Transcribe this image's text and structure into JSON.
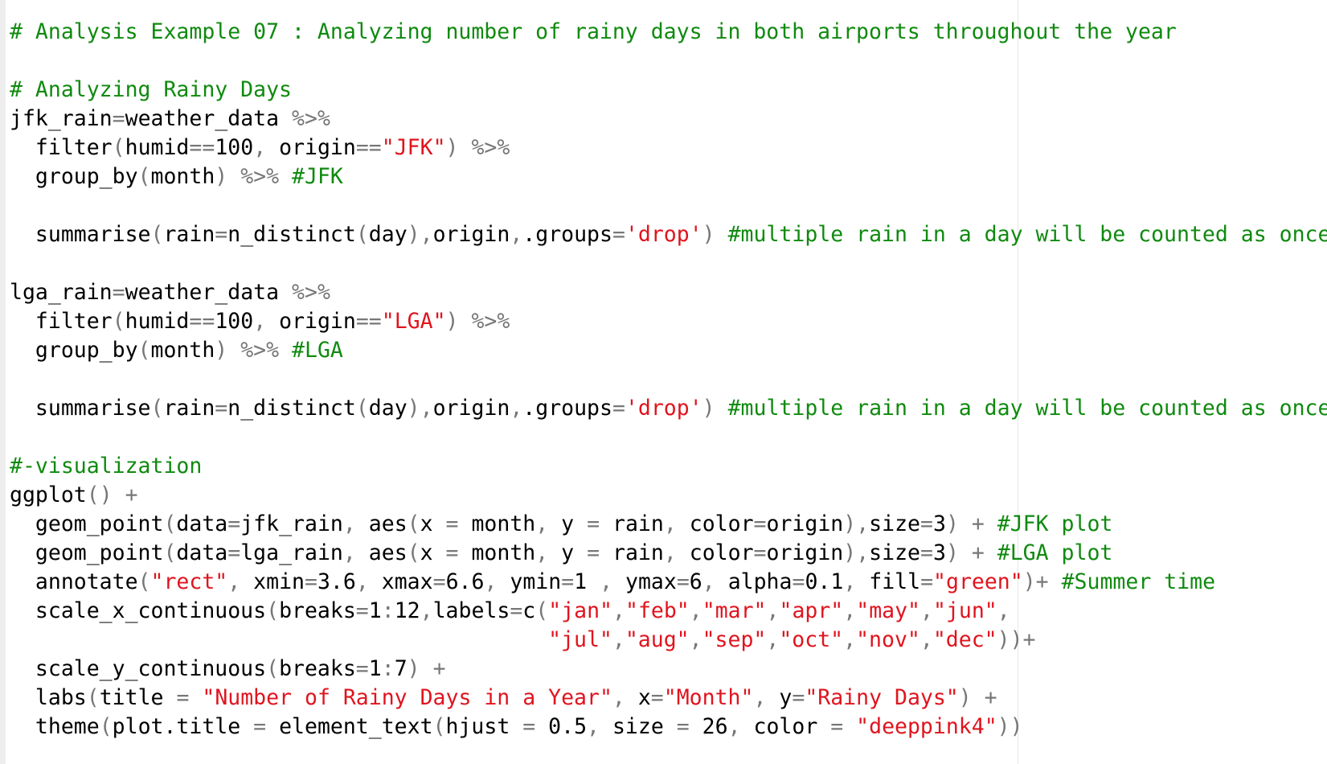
{
  "editor": {
    "language": "R",
    "colors": {
      "comment": "#0f8a0f",
      "string": "#e0141e",
      "operator": "#777777",
      "plain": "#000000",
      "background": "#ffffff"
    },
    "lines": [
      [
        {
          "t": "comment",
          "v": "# Analysis Example 07 : Analyzing number of rainy days in both airports throughout the year"
        }
      ],
      [],
      [
        {
          "t": "comment",
          "v": "# Analyzing Rainy Days"
        }
      ],
      [
        {
          "t": "plain",
          "v": "jfk_rain"
        },
        {
          "t": "op",
          "v": "="
        },
        {
          "t": "plain",
          "v": "weather_data "
        },
        {
          "t": "op",
          "v": "%>%"
        }
      ],
      [
        {
          "t": "plain",
          "v": "  filter"
        },
        {
          "t": "op",
          "v": "("
        },
        {
          "t": "plain",
          "v": "humid"
        },
        {
          "t": "op",
          "v": "=="
        },
        {
          "t": "plain",
          "v": "100"
        },
        {
          "t": "op",
          "v": ", "
        },
        {
          "t": "plain",
          "v": "origin"
        },
        {
          "t": "op",
          "v": "=="
        },
        {
          "t": "string",
          "v": "\"JFK\""
        },
        {
          "t": "op",
          "v": ") %>%"
        }
      ],
      [
        {
          "t": "plain",
          "v": "  group_by"
        },
        {
          "t": "op",
          "v": "("
        },
        {
          "t": "plain",
          "v": "month"
        },
        {
          "t": "op",
          "v": ") %>% "
        },
        {
          "t": "comment",
          "v": "#JFK"
        }
      ],
      [],
      [
        {
          "t": "plain",
          "v": "  summarise"
        },
        {
          "t": "op",
          "v": "("
        },
        {
          "t": "plain",
          "v": "rain"
        },
        {
          "t": "op",
          "v": "="
        },
        {
          "t": "plain",
          "v": "n_distinct"
        },
        {
          "t": "op",
          "v": "("
        },
        {
          "t": "plain",
          "v": "day"
        },
        {
          "t": "op",
          "v": "),"
        },
        {
          "t": "plain",
          "v": "origin"
        },
        {
          "t": "op",
          "v": ","
        },
        {
          "t": "plain",
          "v": ".groups"
        },
        {
          "t": "op",
          "v": "="
        },
        {
          "t": "string",
          "v": "'drop'"
        },
        {
          "t": "op",
          "v": ") "
        },
        {
          "t": "comment",
          "v": "#multiple rain in a day will be counted as once"
        }
      ],
      [],
      [
        {
          "t": "plain",
          "v": "lga_rain"
        },
        {
          "t": "op",
          "v": "="
        },
        {
          "t": "plain",
          "v": "weather_data "
        },
        {
          "t": "op",
          "v": "%>%"
        }
      ],
      [
        {
          "t": "plain",
          "v": "  filter"
        },
        {
          "t": "op",
          "v": "("
        },
        {
          "t": "plain",
          "v": "humid"
        },
        {
          "t": "op",
          "v": "=="
        },
        {
          "t": "plain",
          "v": "100"
        },
        {
          "t": "op",
          "v": ", "
        },
        {
          "t": "plain",
          "v": "origin"
        },
        {
          "t": "op",
          "v": "=="
        },
        {
          "t": "string",
          "v": "\"LGA\""
        },
        {
          "t": "op",
          "v": ") %>%"
        }
      ],
      [
        {
          "t": "plain",
          "v": "  group_by"
        },
        {
          "t": "op",
          "v": "("
        },
        {
          "t": "plain",
          "v": "month"
        },
        {
          "t": "op",
          "v": ") %>% "
        },
        {
          "t": "comment",
          "v": "#LGA"
        }
      ],
      [],
      [
        {
          "t": "plain",
          "v": "  summarise"
        },
        {
          "t": "op",
          "v": "("
        },
        {
          "t": "plain",
          "v": "rain"
        },
        {
          "t": "op",
          "v": "="
        },
        {
          "t": "plain",
          "v": "n_distinct"
        },
        {
          "t": "op",
          "v": "("
        },
        {
          "t": "plain",
          "v": "day"
        },
        {
          "t": "op",
          "v": "),"
        },
        {
          "t": "plain",
          "v": "origin"
        },
        {
          "t": "op",
          "v": ","
        },
        {
          "t": "plain",
          "v": ".groups"
        },
        {
          "t": "op",
          "v": "="
        },
        {
          "t": "string",
          "v": "'drop'"
        },
        {
          "t": "op",
          "v": ") "
        },
        {
          "t": "comment",
          "v": "#multiple rain in a day will be counted as once"
        }
      ],
      [],
      [
        {
          "t": "comment",
          "v": "#-visualization"
        }
      ],
      [
        {
          "t": "plain",
          "v": "ggplot"
        },
        {
          "t": "op",
          "v": "() +"
        }
      ],
      [
        {
          "t": "plain",
          "v": "  geom_point"
        },
        {
          "t": "op",
          "v": "("
        },
        {
          "t": "plain",
          "v": "data"
        },
        {
          "t": "op",
          "v": "="
        },
        {
          "t": "plain",
          "v": "jfk_rain"
        },
        {
          "t": "op",
          "v": ", "
        },
        {
          "t": "plain",
          "v": "aes"
        },
        {
          "t": "op",
          "v": "("
        },
        {
          "t": "plain",
          "v": "x "
        },
        {
          "t": "op",
          "v": "= "
        },
        {
          "t": "plain",
          "v": "month"
        },
        {
          "t": "op",
          "v": ", "
        },
        {
          "t": "plain",
          "v": "y "
        },
        {
          "t": "op",
          "v": "= "
        },
        {
          "t": "plain",
          "v": "rain"
        },
        {
          "t": "op",
          "v": ", "
        },
        {
          "t": "plain",
          "v": "color"
        },
        {
          "t": "op",
          "v": "="
        },
        {
          "t": "plain",
          "v": "origin"
        },
        {
          "t": "op",
          "v": "),"
        },
        {
          "t": "plain",
          "v": "size"
        },
        {
          "t": "op",
          "v": "="
        },
        {
          "t": "plain",
          "v": "3"
        },
        {
          "t": "op",
          "v": ") + "
        },
        {
          "t": "comment",
          "v": "#JFK plot"
        }
      ],
      [
        {
          "t": "plain",
          "v": "  geom_point"
        },
        {
          "t": "op",
          "v": "("
        },
        {
          "t": "plain",
          "v": "data"
        },
        {
          "t": "op",
          "v": "="
        },
        {
          "t": "plain",
          "v": "lga_rain"
        },
        {
          "t": "op",
          "v": ", "
        },
        {
          "t": "plain",
          "v": "aes"
        },
        {
          "t": "op",
          "v": "("
        },
        {
          "t": "plain",
          "v": "x "
        },
        {
          "t": "op",
          "v": "= "
        },
        {
          "t": "plain",
          "v": "month"
        },
        {
          "t": "op",
          "v": ", "
        },
        {
          "t": "plain",
          "v": "y "
        },
        {
          "t": "op",
          "v": "= "
        },
        {
          "t": "plain",
          "v": "rain"
        },
        {
          "t": "op",
          "v": ", "
        },
        {
          "t": "plain",
          "v": "color"
        },
        {
          "t": "op",
          "v": "="
        },
        {
          "t": "plain",
          "v": "origin"
        },
        {
          "t": "op",
          "v": "),"
        },
        {
          "t": "plain",
          "v": "size"
        },
        {
          "t": "op",
          "v": "="
        },
        {
          "t": "plain",
          "v": "3"
        },
        {
          "t": "op",
          "v": ") + "
        },
        {
          "t": "comment",
          "v": "#LGA plot"
        }
      ],
      [
        {
          "t": "plain",
          "v": "  annotate"
        },
        {
          "t": "op",
          "v": "("
        },
        {
          "t": "string",
          "v": "\"rect\""
        },
        {
          "t": "op",
          "v": ", "
        },
        {
          "t": "plain",
          "v": "xmin"
        },
        {
          "t": "op",
          "v": "="
        },
        {
          "t": "plain",
          "v": "3.6"
        },
        {
          "t": "op",
          "v": ", "
        },
        {
          "t": "plain",
          "v": "xmax"
        },
        {
          "t": "op",
          "v": "="
        },
        {
          "t": "plain",
          "v": "6.6"
        },
        {
          "t": "op",
          "v": ", "
        },
        {
          "t": "plain",
          "v": "ymin"
        },
        {
          "t": "op",
          "v": "="
        },
        {
          "t": "plain",
          "v": "1 "
        },
        {
          "t": "op",
          "v": ", "
        },
        {
          "t": "plain",
          "v": "ymax"
        },
        {
          "t": "op",
          "v": "="
        },
        {
          "t": "plain",
          "v": "6"
        },
        {
          "t": "op",
          "v": ", "
        },
        {
          "t": "plain",
          "v": "alpha"
        },
        {
          "t": "op",
          "v": "="
        },
        {
          "t": "plain",
          "v": "0.1"
        },
        {
          "t": "op",
          "v": ", "
        },
        {
          "t": "plain",
          "v": "fill"
        },
        {
          "t": "op",
          "v": "="
        },
        {
          "t": "string",
          "v": "\"green\""
        },
        {
          "t": "op",
          "v": ")+ "
        },
        {
          "t": "comment",
          "v": "#Summer time"
        }
      ],
      [
        {
          "t": "plain",
          "v": "  scale_x_continuous"
        },
        {
          "t": "op",
          "v": "("
        },
        {
          "t": "plain",
          "v": "breaks"
        },
        {
          "t": "op",
          "v": "="
        },
        {
          "t": "plain",
          "v": "1"
        },
        {
          "t": "op",
          "v": ":"
        },
        {
          "t": "plain",
          "v": "12"
        },
        {
          "t": "op",
          "v": ","
        },
        {
          "t": "plain",
          "v": "labels"
        },
        {
          "t": "op",
          "v": "="
        },
        {
          "t": "plain",
          "v": "c"
        },
        {
          "t": "op",
          "v": "("
        },
        {
          "t": "string",
          "v": "\"jan\""
        },
        {
          "t": "op",
          "v": ","
        },
        {
          "t": "string",
          "v": "\"feb\""
        },
        {
          "t": "op",
          "v": ","
        },
        {
          "t": "string",
          "v": "\"mar\""
        },
        {
          "t": "op",
          "v": ","
        },
        {
          "t": "string",
          "v": "\"apr\""
        },
        {
          "t": "op",
          "v": ","
        },
        {
          "t": "string",
          "v": "\"may\""
        },
        {
          "t": "op",
          "v": ","
        },
        {
          "t": "string",
          "v": "\"jun\""
        },
        {
          "t": "op",
          "v": ","
        }
      ],
      [
        {
          "t": "plain",
          "v": "                                          "
        },
        {
          "t": "string",
          "v": "\"jul\""
        },
        {
          "t": "op",
          "v": ","
        },
        {
          "t": "string",
          "v": "\"aug\""
        },
        {
          "t": "op",
          "v": ","
        },
        {
          "t": "string",
          "v": "\"sep\""
        },
        {
          "t": "op",
          "v": ","
        },
        {
          "t": "string",
          "v": "\"oct\""
        },
        {
          "t": "op",
          "v": ","
        },
        {
          "t": "string",
          "v": "\"nov\""
        },
        {
          "t": "op",
          "v": ","
        },
        {
          "t": "string",
          "v": "\"dec\""
        },
        {
          "t": "op",
          "v": "))+"
        }
      ],
      [
        {
          "t": "plain",
          "v": "  scale_y_continuous"
        },
        {
          "t": "op",
          "v": "("
        },
        {
          "t": "plain",
          "v": "breaks"
        },
        {
          "t": "op",
          "v": "="
        },
        {
          "t": "plain",
          "v": "1"
        },
        {
          "t": "op",
          "v": ":"
        },
        {
          "t": "plain",
          "v": "7"
        },
        {
          "t": "op",
          "v": ") +"
        }
      ],
      [
        {
          "t": "plain",
          "v": "  labs"
        },
        {
          "t": "op",
          "v": "("
        },
        {
          "t": "plain",
          "v": "title "
        },
        {
          "t": "op",
          "v": "= "
        },
        {
          "t": "string",
          "v": "\"Number of Rainy Days in a Year\""
        },
        {
          "t": "op",
          "v": ", "
        },
        {
          "t": "plain",
          "v": "x"
        },
        {
          "t": "op",
          "v": "="
        },
        {
          "t": "string",
          "v": "\"Month\""
        },
        {
          "t": "op",
          "v": ", "
        },
        {
          "t": "plain",
          "v": "y"
        },
        {
          "t": "op",
          "v": "="
        },
        {
          "t": "string",
          "v": "\"Rainy Days\""
        },
        {
          "t": "op",
          "v": ") +"
        }
      ],
      [
        {
          "t": "plain",
          "v": "  theme"
        },
        {
          "t": "op",
          "v": "("
        },
        {
          "t": "plain",
          "v": "plot.title "
        },
        {
          "t": "op",
          "v": "= "
        },
        {
          "t": "plain",
          "v": "element_text"
        },
        {
          "t": "op",
          "v": "("
        },
        {
          "t": "plain",
          "v": "hjust "
        },
        {
          "t": "op",
          "v": "= "
        },
        {
          "t": "plain",
          "v": "0.5"
        },
        {
          "t": "op",
          "v": ", "
        },
        {
          "t": "plain",
          "v": "size "
        },
        {
          "t": "op",
          "v": "= "
        },
        {
          "t": "plain",
          "v": "26"
        },
        {
          "t": "op",
          "v": ", "
        },
        {
          "t": "plain",
          "v": "color "
        },
        {
          "t": "op",
          "v": "= "
        },
        {
          "t": "string",
          "v": "\"deeppink4\""
        },
        {
          "t": "op",
          "v": "))"
        }
      ]
    ]
  }
}
